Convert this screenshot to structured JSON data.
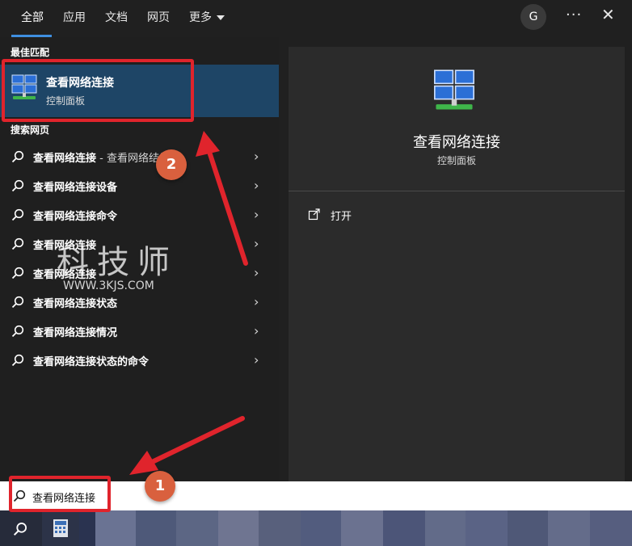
{
  "tabs": [
    {
      "label": "全部",
      "active": true
    },
    {
      "label": "应用"
    },
    {
      "label": "文档"
    },
    {
      "label": "网页"
    },
    {
      "label": "更多"
    }
  ],
  "header": {
    "avatar_letter": "G",
    "more_glyph": "···",
    "close_glyph": "✕"
  },
  "best_match": {
    "section_label": "最佳匹配",
    "title": "查看网络连接",
    "subtitle": "控制面板",
    "icon": "network-connections-icon"
  },
  "web_section_label": "搜索网页",
  "web_results": [
    {
      "text": "查看网络连接",
      "extra": " - 查看网络结果"
    },
    {
      "text": "查看网络连接设备"
    },
    {
      "text": "查看网络连接命令"
    },
    {
      "text": "查看网络连接"
    },
    {
      "text": "查看网络连接"
    },
    {
      "text": "查看网络连接状态"
    },
    {
      "text": "查看网络连接情况"
    },
    {
      "text": "查看网络连接状态的命令"
    }
  ],
  "preview": {
    "title": "查看网络连接",
    "subtitle": "控制面板",
    "action_open": "打开"
  },
  "search": {
    "query": "查看网络连接"
  },
  "annotations": {
    "badge_1": "1",
    "badge_2": "2"
  },
  "watermark": {
    "text": "科技师",
    "url": "WWW.3KJS.COM"
  },
  "colors": {
    "accent": "#3f8fe0",
    "highlight": "#1e4566",
    "annotation_red": "#e0242c",
    "badge": "#d9603e"
  }
}
